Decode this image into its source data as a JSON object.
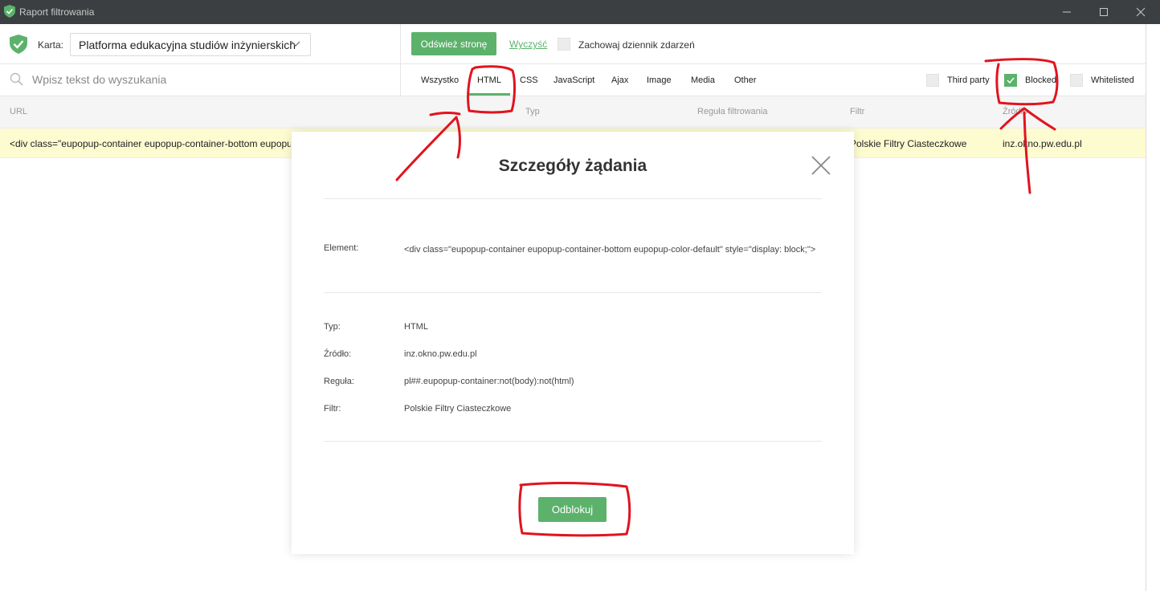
{
  "window": {
    "title": "Raport filtrowania",
    "controls": [
      "minimize-icon",
      "maximize-icon",
      "close-icon"
    ]
  },
  "toolbar": {
    "tab_label": "Karta:",
    "tab_select_value": "Platforma edukacyjna studiów inżynierskich",
    "refresh_label": "Odśwież stronę",
    "clear_label": "Wyczyść",
    "keep_log_label": "Zachowaj dziennik zdarzeń",
    "keep_log_checked": false
  },
  "search": {
    "placeholder": "Wpisz tekst do wyszukania",
    "value": ""
  },
  "filters": {
    "tabs": [
      "Wszystko",
      "HTML",
      "CSS",
      "JavaScript",
      "Ajax",
      "Image",
      "Media",
      "Other"
    ],
    "active_tab": "HTML",
    "checkboxes": [
      {
        "label": "Third party",
        "checked": false
      },
      {
        "label": "Blocked",
        "checked": true
      },
      {
        "label": "Whitelisted",
        "checked": false
      }
    ]
  },
  "table": {
    "columns": [
      "URL",
      "Typ",
      "Reguła filtrowania",
      "Filtr",
      "Źródło"
    ],
    "rows": [
      {
        "url": "<div class=\"eupopup-container eupopup-container-bottom eupopup-color-default\" style=\"display: block;\">",
        "filter": "Polskie Filtry Ciasteczkowe",
        "source": "inz.okno.pw.edu.pl"
      }
    ]
  },
  "modal": {
    "title": "Szczegóły żądania",
    "element_label": "Element:",
    "element_value": "<div class=\"eupopup-container eupopup-container-bottom eupopup-color-default\" style=\"display: block;\">",
    "type_label": "Typ:",
    "type_value": "HTML",
    "source_label": "Źródło:",
    "source_value": "inz.okno.pw.edu.pl",
    "rule_label": "Reguła:",
    "rule_value": "pl##.eupopup-container:not(body):not(html)",
    "filter_label": "Filtr:",
    "filter_value": "Polskie Filtry Ciasteczkowe",
    "unblock_label": "Odblokuj"
  },
  "colors": {
    "accent": "#5cb26b",
    "titlebar": "#3c3f41",
    "row_highlight": "#fdfbd0",
    "annotation": "#e0141e"
  }
}
